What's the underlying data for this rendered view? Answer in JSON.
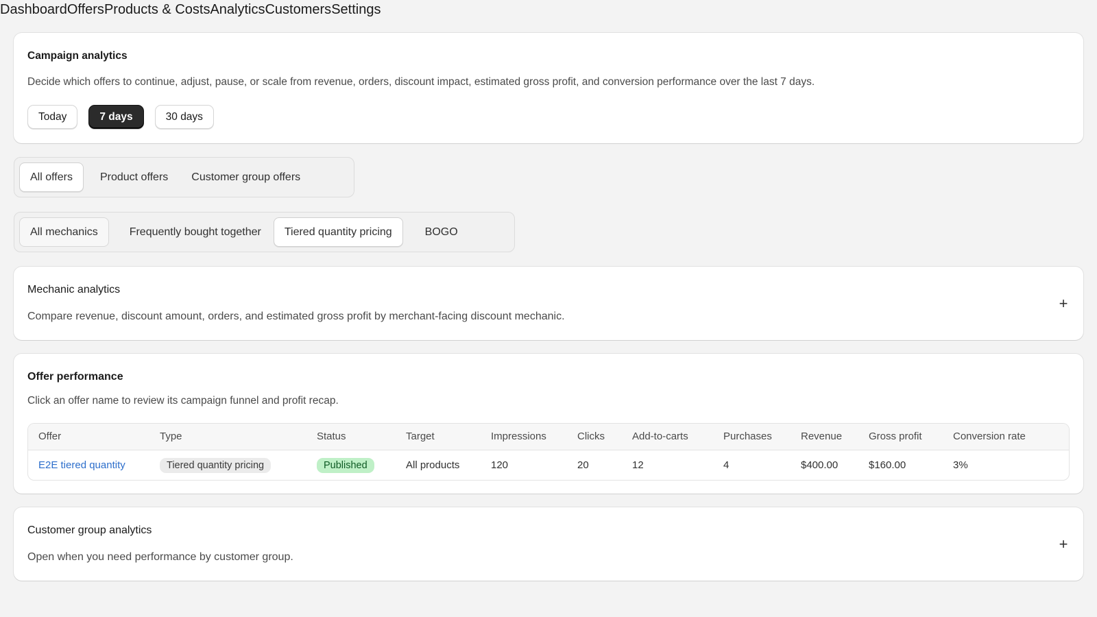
{
  "nav": {
    "items": [
      "Dashboard",
      "Offers",
      "Products & Costs",
      "Analytics",
      "Customers",
      "Settings"
    ]
  },
  "campaign": {
    "title": "Campaign analytics",
    "description": "Decide which offers to continue, adjust, pause, or scale from revenue, orders, discount impact, estimated gross profit, and conversion performance over the last 7 days.",
    "ranges": [
      "Today",
      "7 days",
      "30 days"
    ],
    "selected_range": "7 days"
  },
  "scope_tabs": {
    "items": [
      "All offers",
      "Product offers",
      "Customer group offers"
    ],
    "selected": "All offers"
  },
  "mechanic_tabs": {
    "items": [
      "All mechanics",
      "Frequently bought together",
      "Tiered quantity pricing",
      "BOGO"
    ]
  },
  "mechanic_analytics": {
    "title": "Mechanic analytics",
    "description": "Compare revenue, discount amount, orders, and estimated gross profit by merchant-facing discount mechanic.",
    "expand_glyph": "+"
  },
  "offer_performance": {
    "title": "Offer performance",
    "description": "Click an offer name to review its campaign funnel and profit recap.",
    "columns": [
      "Offer",
      "Type",
      "Status",
      "Target",
      "Impressions",
      "Clicks",
      "Add-to-carts",
      "Purchases",
      "Revenue",
      "Gross profit",
      "Conversion rate"
    ],
    "rows": [
      {
        "offer": "E2E tiered quantity",
        "type": "Tiered quantity pricing",
        "status": "Published",
        "target": "All products",
        "impressions": "120",
        "clicks": "20",
        "add_to_carts": "12",
        "purchases": "4",
        "revenue": "$400.00",
        "gross_profit": "$160.00",
        "conversion_rate": "3%"
      }
    ]
  },
  "customer_group_analytics": {
    "title": "Customer group analytics",
    "description": "Open when you need performance by customer group.",
    "expand_glyph": "+"
  },
  "colors": {
    "page_bg": "#f3f3f3",
    "selected_button_bg": "#2b2b2b",
    "link": "#2c6ecb",
    "status_published_bg": "#bff0c7"
  }
}
